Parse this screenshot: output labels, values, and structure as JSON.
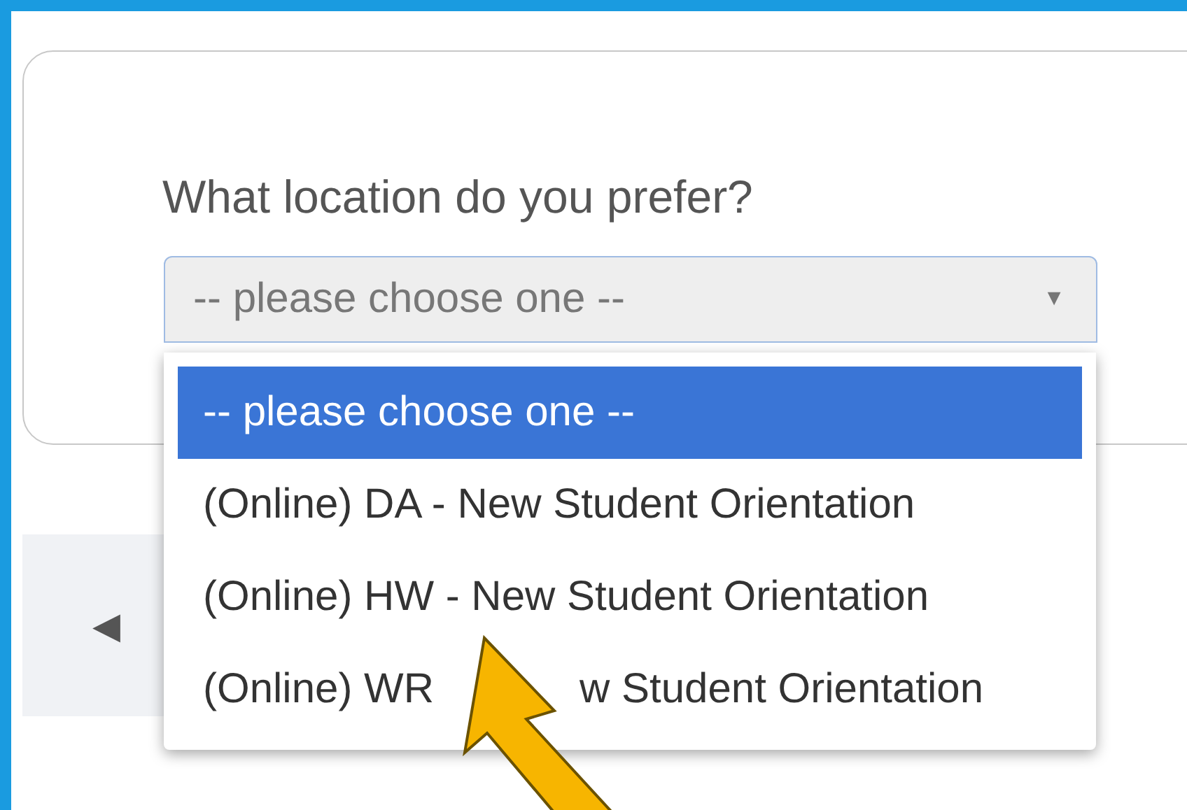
{
  "question": {
    "label": "What location do you prefer?",
    "select": {
      "value": "-- please choose one --",
      "expanded": true,
      "arrow": "▼"
    },
    "options": [
      {
        "label": "-- please choose one --",
        "selected": true
      },
      {
        "label": "(Online) DA - New Student Orientation",
        "selected": false
      },
      {
        "label": "(Online) HW - New Student Orientation",
        "selected": false
      },
      {
        "label": "(Online) WR",
        "label_after_annotation": "w Student Orientation",
        "selected": false
      }
    ]
  },
  "navigation": {
    "back": "◀"
  },
  "annotation": {
    "kind": "arrow",
    "color": "#f7b500"
  }
}
